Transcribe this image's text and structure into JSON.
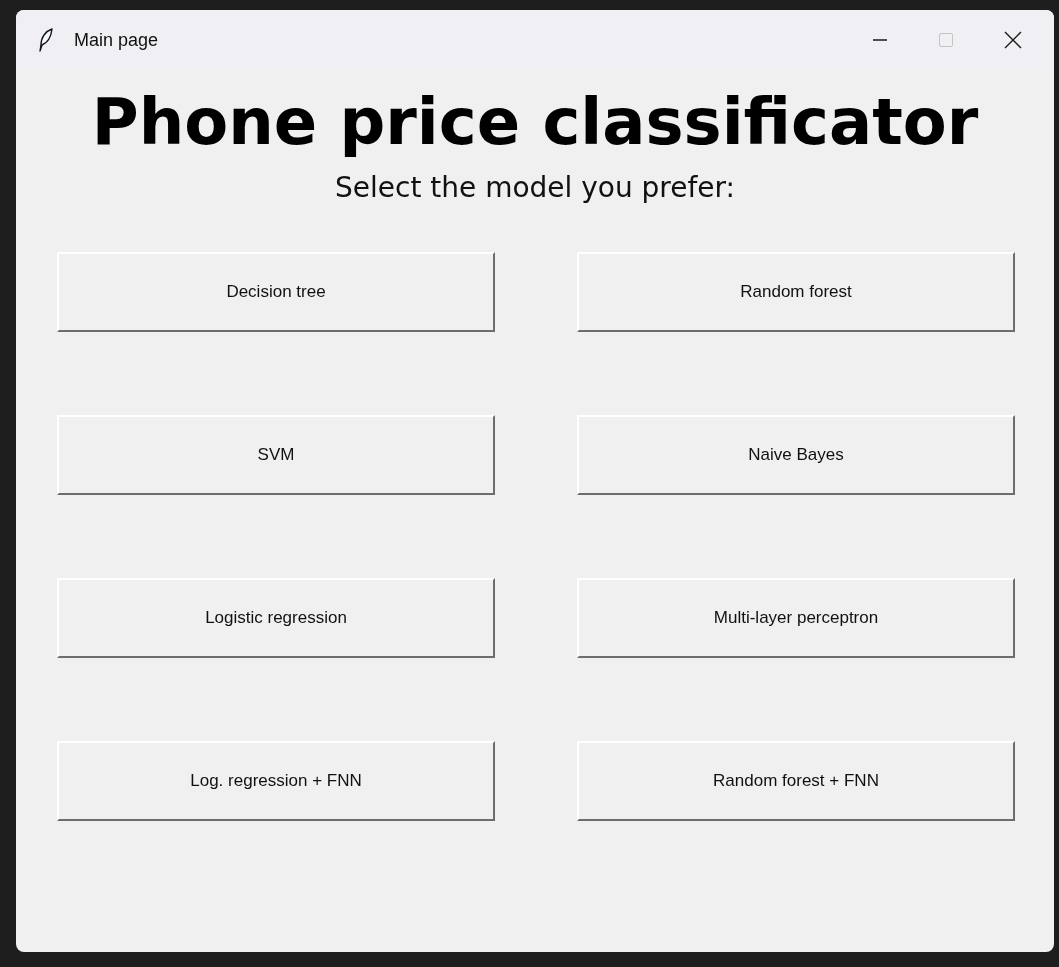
{
  "window": {
    "title": "Main page",
    "controls": [
      {
        "kind": "minimize",
        "disabled": false
      },
      {
        "kind": "maximize",
        "disabled": true
      },
      {
        "kind": "close",
        "disabled": false
      }
    ]
  },
  "heading": "Phone price classificator",
  "subtitle": "Select the model you prefer:",
  "buttons": [
    "Decision tree",
    "Random forest",
    "SVM",
    "Naive Bayes",
    "Logistic regression",
    "Multi-layer perceptron",
    "Log. regression + FNN",
    "Random forest + FNN"
  ]
}
